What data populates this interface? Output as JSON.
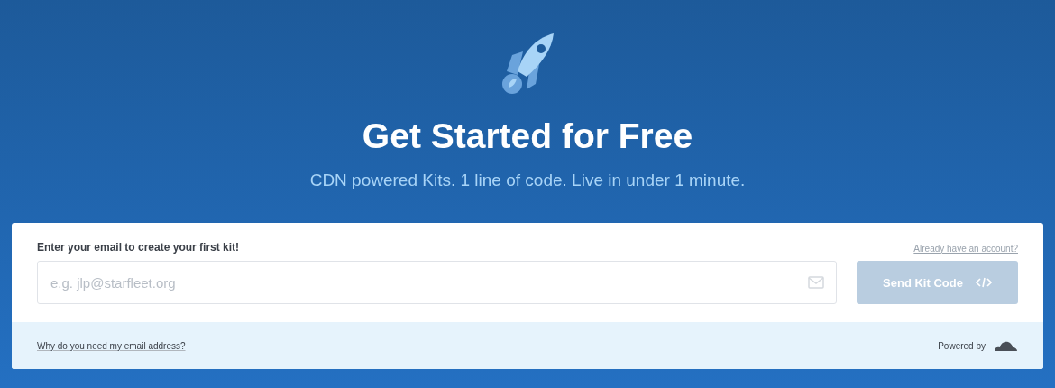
{
  "hero": {
    "title": "Get Started for Free",
    "subtitle": "CDN powered Kits. 1 line of code. Live in under 1 minute."
  },
  "form": {
    "label": "Enter your email to create your first kit!",
    "account_link": "Already have an account?",
    "email_field": {
      "placeholder": "e.g. jlp@starfleet.org"
    },
    "submit": {
      "label": "Send Kit Code",
      "disabled": true
    }
  },
  "footer": {
    "help_link": "Why do you need my email address?",
    "powered_by": "Powered by"
  }
}
